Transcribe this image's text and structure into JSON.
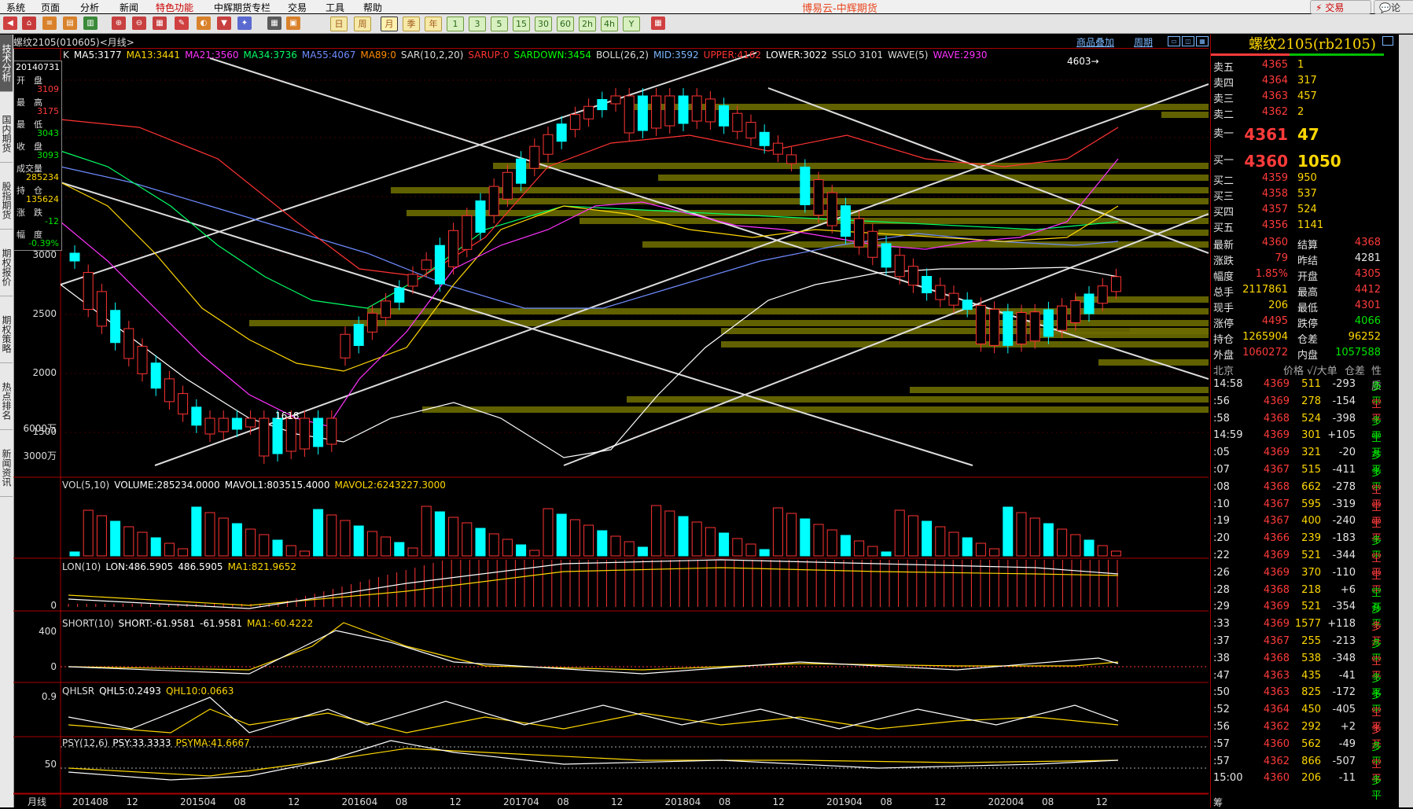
{
  "menu": {
    "items": [
      "系统",
      "页面",
      "分析",
      "新闻",
      "特色功能",
      "中辉期货专栏",
      "交易",
      "工具",
      "帮助"
    ],
    "title": "博易云-中辉期货",
    "trade_button": "交易",
    "comment_button": "论"
  },
  "toolbar": {
    "period_buttons": [
      "日",
      "周",
      "月",
      "季",
      "年"
    ],
    "minute_buttons": [
      "1",
      "3",
      "5",
      "15",
      "30",
      "60",
      "2h",
      "4h",
      "Y"
    ]
  },
  "sidebar": {
    "tabs": [
      "技术分析",
      "国内期货",
      "股指期货",
      "期权报价",
      "期权策略",
      "热点排名",
      "新闻资讯"
    ]
  },
  "chart": {
    "title": "螺纹2105(010605)<月线>",
    "links": [
      "商品叠加",
      "周期"
    ],
    "main_indicators": [
      {
        "text": "K",
        "color": "#dddddd"
      },
      {
        "text": "MA5:3177",
        "color": "#ffffff"
      },
      {
        "text": "MA13:3441",
        "color": "#ffd700"
      },
      {
        "text": "MA21:3560",
        "color": "#ff33ff"
      },
      {
        "text": "MA34:3736",
        "color": "#00ff66"
      },
      {
        "text": "MA55:4067",
        "color": "#6e8cff"
      },
      {
        "text": "MA89:0",
        "color": "#ff8c00"
      },
      {
        "text": "SAR(10,2,20)",
        "color": "#dddddd"
      },
      {
        "text": "SARUP:0",
        "color": "#ff3333"
      },
      {
        "text": "SARDOWN:3454",
        "color": "#00ff00"
      },
      {
        "text": "BOLL(26,2)",
        "color": "#dddddd"
      },
      {
        "text": "MID:3592",
        "color": "#7ab7ff"
      },
      {
        "text": "UPPER:4162",
        "color": "#ff3333"
      },
      {
        "text": "LOWER:3022",
        "color": "#ffffff"
      },
      {
        "text": "SSLO 3101",
        "color": "#dddddd"
      },
      {
        "text": "WAVE(5)",
        "color": "#dddddd"
      },
      {
        "text": "WAVE:2930",
        "color": "#ff33ff"
      }
    ],
    "price_ticks": [
      "3000",
      "2500",
      "2000",
      "1500"
    ],
    "annotations": {
      "high": "4603",
      "low": "1618"
    },
    "vol_indicators": [
      {
        "text": "VOL(5,10)",
        "color": "#dddddd"
      },
      {
        "text": "VOLUME:285234.0000",
        "color": "#ffffff"
      },
      {
        "text": "MAVOL1:803515.4000",
        "color": "#ffffff"
      },
      {
        "text": "MAVOL2:6243227.3000",
        "color": "#ffd700"
      }
    ],
    "vol_ticks": [
      "6000万",
      "3000万"
    ],
    "lon_indicators": [
      {
        "text": "LON(10)",
        "color": "#dddddd"
      },
      {
        "text": "LON:486.5905",
        "color": "#ffffff"
      },
      {
        "text": "486.5905",
        "color": "#ffffff"
      },
      {
        "text": "MA1:821.9652",
        "color": "#ffd700"
      }
    ],
    "lon_ticks": [
      "0"
    ],
    "short_indicators": [
      {
        "text": "SHORT(10)",
        "color": "#dddddd"
      },
      {
        "text": "SHORT:-61.9581",
        "color": "#ffffff"
      },
      {
        "text": "-61.9581",
        "color": "#ffffff"
      },
      {
        "text": "MA1:-60.4222",
        "color": "#ffd700"
      }
    ],
    "short_ticks": [
      "400",
      "0"
    ],
    "qhlsr_indicators": [
      {
        "text": "QHLSR",
        "color": "#dddddd"
      },
      {
        "text": "QHL5:0.2493",
        "color": "#ffffff"
      },
      {
        "text": "QHL10:0.0663",
        "color": "#ffd700"
      }
    ],
    "qhlsr_ticks": [
      "0.9"
    ],
    "psy_indicators": [
      {
        "text": "PSY(12,6)",
        "color": "#dddddd"
      },
      {
        "text": "PSY:33.3333",
        "color": "#ffffff"
      },
      {
        "text": "PSYMA:41.6667",
        "color": "#ffd700"
      }
    ],
    "psy_ticks": [
      "50"
    ],
    "period_label": "月线",
    "x_ticks": [
      "201408",
      "12",
      "201504",
      "08",
      "12",
      "201604",
      "08",
      "12",
      "201704",
      "08",
      "12",
      "201804",
      "08",
      "12",
      "201904",
      "08",
      "12",
      "202004",
      "08",
      "12"
    ]
  },
  "infobox": {
    "date": "20140731",
    "rows": [
      {
        "label": "开　盘",
        "value": "3109",
        "color": "#ff3b3b"
      },
      {
        "label": "最　高",
        "value": "3175",
        "color": "#ff3b3b"
      },
      {
        "label": "最　低",
        "value": "3043",
        "color": "#00e600"
      },
      {
        "label": "收　盘",
        "value": "3093",
        "color": "#00e600"
      },
      {
        "label": "成交量",
        "value": "285234",
        "color": "#ffd700"
      },
      {
        "label": "持　仓",
        "value": "135624",
        "color": "#ffd700"
      },
      {
        "label": "涨　跌",
        "value": "-12",
        "color": "#00e600"
      },
      {
        "label": "幅　度",
        "value": "-0.39%",
        "color": "#00e600"
      }
    ]
  },
  "quote": {
    "title": "螺纹2105(rb2105)",
    "asks": [
      {
        "label": "卖五",
        "price": "4365",
        "vol": "1"
      },
      {
        "label": "卖四",
        "price": "4364",
        "vol": "317"
      },
      {
        "label": "卖三",
        "price": "4363",
        "vol": "457"
      },
      {
        "label": "卖二",
        "price": "4362",
        "vol": "2"
      }
    ],
    "ask1": {
      "label": "卖一",
      "price": "4361",
      "vol": "47"
    },
    "bid1": {
      "label": "买一",
      "price": "4360",
      "vol": "1050"
    },
    "bids": [
      {
        "label": "买二",
        "price": "4359",
        "vol": "950"
      },
      {
        "label": "买三",
        "price": "4358",
        "vol": "537"
      },
      {
        "label": "买四",
        "price": "4357",
        "vol": "524"
      },
      {
        "label": "买五",
        "price": "4356",
        "vol": "1141"
      }
    ],
    "stats": [
      {
        "l1": "最新",
        "v1": "4360",
        "c1": "#ff3b3b",
        "l2": "结算",
        "v2": "4368",
        "c2": "#ff3b3b"
      },
      {
        "l1": "涨跌",
        "v1": "79",
        "c1": "#ff3b3b",
        "l2": "昨结",
        "v2": "4281",
        "c2": "#e6e6e6"
      },
      {
        "l1": "幅度",
        "v1": "1.85%",
        "c1": "#ff3b3b",
        "l2": "开盘",
        "v2": "4305",
        "c2": "#ff3b3b"
      },
      {
        "l1": "总手",
        "v1": "2117861",
        "c1": "#ffd700",
        "l2": "最高",
        "v2": "4412",
        "c2": "#ff3b3b"
      },
      {
        "l1": "现手",
        "v1": "206",
        "c1": "#ffd700",
        "l2": "最低",
        "v2": "4301",
        "c2": "#ff3b3b"
      },
      {
        "l1": "涨停",
        "v1": "4495",
        "c1": "#ff3b3b",
        "l2": "跌停",
        "v2": "4066",
        "c2": "#00e600"
      },
      {
        "l1": "持仓",
        "v1": "1265904",
        "c1": "#ffd700",
        "l2": "仓差",
        "v2": "96252",
        "c2": "#ffd700"
      },
      {
        "l1": "外盘",
        "v1": "1060272",
        "c1": "#ff3b3b",
        "l2": "内盘",
        "v2": "1057588",
        "c2": "#00e600"
      }
    ],
    "tick_header": {
      "c1": "北京",
      "c2": "价格",
      "c3": "√/大单",
      "c4": "仓差",
      "c5": "性质"
    },
    "ticks": [
      {
        "t": "14:58",
        "p": "4369",
        "v": "511",
        "d": "-293",
        "n": "多平",
        "nc": "#00e600",
        "dc": "#e6e6e6"
      },
      {
        "t": ":56",
        "p": "4369",
        "v": "278",
        "d": "-154",
        "n": "空平",
        "nc": "#ff3b3b",
        "dc": "#e6e6e6"
      },
      {
        "t": ":58",
        "p": "4368",
        "v": "524",
        "d": "-398",
        "n": "多平",
        "nc": "#00e600",
        "dc": "#e6e6e6"
      },
      {
        "t": "14:59",
        "p": "4369",
        "v": "301",
        "d": "+105",
        "n": "空开",
        "nc": "#00e600",
        "dc": "#e6e6e6"
      },
      {
        "t": ":05",
        "p": "4369",
        "v": "321",
        "d": "-20",
        "n": "多平",
        "nc": "#00e600",
        "dc": "#e6e6e6"
      },
      {
        "t": ":07",
        "p": "4367",
        "v": "515",
        "d": "-411",
        "n": "多平",
        "nc": "#00e600",
        "dc": "#e6e6e6"
      },
      {
        "t": ":08",
        "p": "4368",
        "v": "662",
        "d": "-278",
        "n": "空平",
        "nc": "#ff3b3b",
        "dc": "#e6e6e6"
      },
      {
        "t": ":10",
        "p": "4367",
        "v": "595",
        "d": "-319",
        "n": "空平",
        "nc": "#ff3b3b",
        "dc": "#e6e6e6"
      },
      {
        "t": ":19",
        "p": "4367",
        "v": "400",
        "d": "-240",
        "n": "空平",
        "nc": "#ff3b3b",
        "dc": "#e6e6e6"
      },
      {
        "t": ":20",
        "p": "4366",
        "v": "239",
        "d": "-183",
        "n": "多平",
        "nc": "#00e600",
        "dc": "#e6e6e6"
      },
      {
        "t": ":22",
        "p": "4369",
        "v": "521",
        "d": "-344",
        "n": "空平",
        "nc": "#ff3b3b",
        "dc": "#e6e6e6"
      },
      {
        "t": ":26",
        "p": "4369",
        "v": "370",
        "d": "-110",
        "n": "空平",
        "nc": "#ff3b3b",
        "dc": "#e6e6e6"
      },
      {
        "t": ":28",
        "p": "4368",
        "v": "218",
        "d": "+6",
        "n": "空开",
        "nc": "#00e600",
        "dc": "#e6e6e6"
      },
      {
        "t": ":29",
        "p": "4369",
        "v": "521",
        "d": "-354",
        "n": "多平",
        "nc": "#00e600",
        "dc": "#e6e6e6"
      },
      {
        "t": ":33",
        "p": "4369",
        "v": "1577",
        "d": "+118",
        "n": "多开",
        "nc": "#ff3b3b",
        "dc": "#e6e6e6"
      },
      {
        "t": ":37",
        "p": "4367",
        "v": "255",
        "d": "-213",
        "n": "多平",
        "nc": "#00e600",
        "dc": "#e6e6e6"
      },
      {
        "t": ":38",
        "p": "4368",
        "v": "538",
        "d": "-348",
        "n": "空平",
        "nc": "#ff3b3b",
        "dc": "#e6e6e6"
      },
      {
        "t": ":47",
        "p": "4363",
        "v": "435",
        "d": "-41",
        "n": "多平",
        "nc": "#00e600",
        "dc": "#e6e6e6"
      },
      {
        "t": ":50",
        "p": "4363",
        "v": "825",
        "d": "-172",
        "n": "多平",
        "nc": "#00e600",
        "dc": "#e6e6e6"
      },
      {
        "t": ":52",
        "p": "4364",
        "v": "450",
        "d": "-405",
        "n": "空平",
        "nc": "#ff3b3b",
        "dc": "#e6e6e6"
      },
      {
        "t": ":56",
        "p": "4362",
        "v": "292",
        "d": "+2",
        "n": "多开",
        "nc": "#ff3b3b",
        "dc": "#e6e6e6"
      },
      {
        "t": ":57",
        "p": "4360",
        "v": "562",
        "d": "-49",
        "n": "多平",
        "nc": "#00e600",
        "dc": "#e6e6e6"
      },
      {
        "t": ":57",
        "p": "4362",
        "v": "866",
        "d": "-507",
        "n": "空平",
        "nc": "#ff3b3b",
        "dc": "#e6e6e6"
      },
      {
        "t": "15:00",
        "p": "4360",
        "v": "206",
        "d": "-11",
        "n": "多平",
        "nc": "#00e600",
        "dc": "#e6e6e6"
      }
    ],
    "bottom_label": "筹"
  }
}
